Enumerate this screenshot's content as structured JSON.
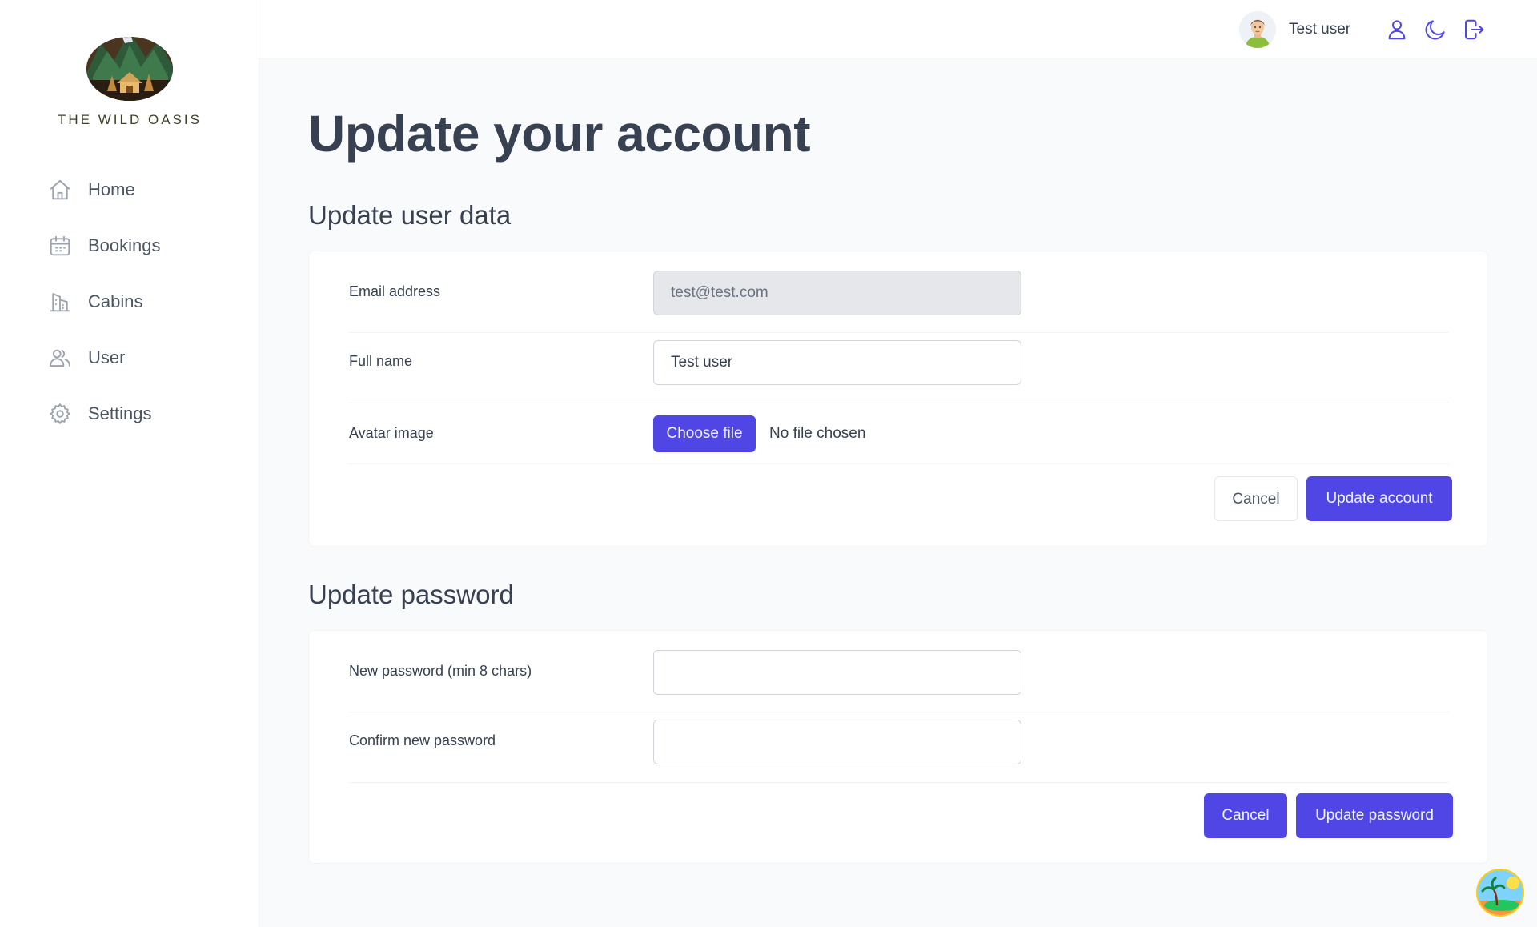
{
  "brand": {
    "name": "THE WILD OASIS"
  },
  "sidebar": {
    "items": [
      {
        "label": "Home",
        "icon": "home-icon"
      },
      {
        "label": "Bookings",
        "icon": "calendar-icon"
      },
      {
        "label": "Cabins",
        "icon": "building-icon"
      },
      {
        "label": "User",
        "icon": "users-icon"
      },
      {
        "label": "Settings",
        "icon": "gear-icon"
      }
    ]
  },
  "header": {
    "user_name": "Test user",
    "icons": [
      "user-icon",
      "moon-icon",
      "logout-icon"
    ]
  },
  "main": {
    "title": "Update your account",
    "user_data": {
      "title": "Update user data",
      "email_label": "Email address",
      "email_value": "test@test.com",
      "fullname_label": "Full name",
      "fullname_value": "Test user",
      "avatar_label": "Avatar image",
      "file_button": "Choose file",
      "file_status": "No file chosen",
      "cancel_label": "Cancel",
      "submit_label": "Update account"
    },
    "password": {
      "title": "Update password",
      "new_label": "New password (min 8 chars)",
      "new_value": "",
      "confirm_label": "Confirm new password",
      "confirm_value": "",
      "cancel_label": "Cancel",
      "submit_label": "Update password"
    }
  },
  "colors": {
    "accent": "#4f46e5",
    "background": "#f9fafb",
    "text": "#374151"
  }
}
